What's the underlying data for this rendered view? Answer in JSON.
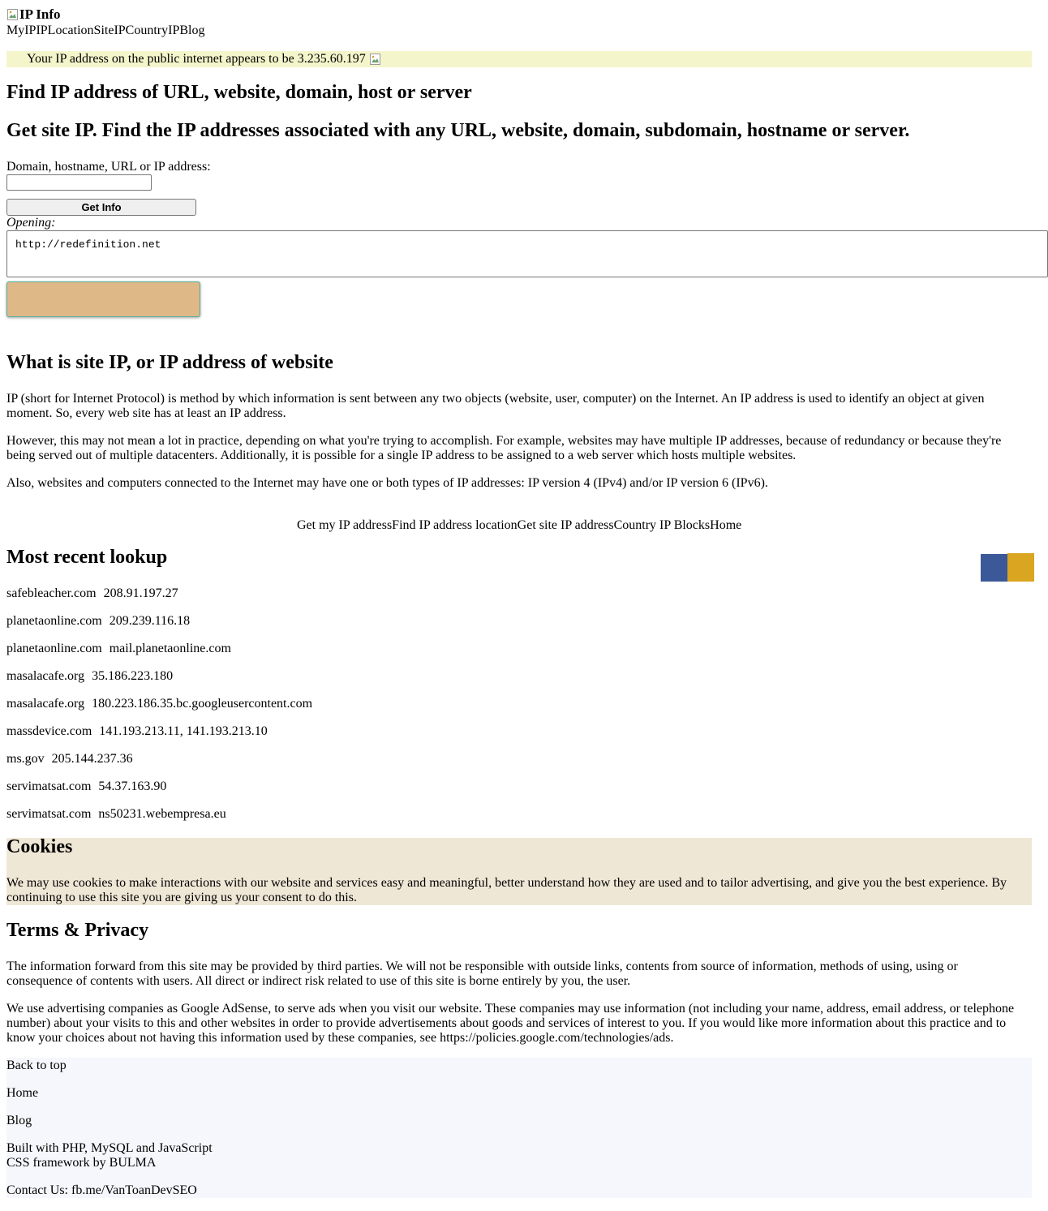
{
  "header": {
    "logo_alt": "IP Info",
    "nav": [
      "MyIP",
      "IPLocation",
      "SiteIP",
      "CountryIP",
      "Blog"
    ]
  },
  "ip_banner": {
    "text": "Your IP address on the public internet appears to be 3.235.60.197"
  },
  "main": {
    "title": "Find IP address of URL, website, domain, host or server",
    "subtitle": "Get site IP. Find the IP addresses associated with any URL, website, domain, subdomain, hostname or server.",
    "input_label": "Domain, hostname, URL or IP address:",
    "input_value": "",
    "button_label": "Get Info",
    "opening_label": "Opening:",
    "opening_value": "http://redefinition.net"
  },
  "about": {
    "heading": "What is site IP, or IP address of website",
    "paragraphs": [
      "IP (short for Internet Protocol) is method by which information is sent between any two objects (website, user, computer) on the Internet. An IP address is used to identify an object at given moment. So, every web site has at least an IP address.",
      "However, this may not mean a lot in practice, depending on what you're trying to accomplish. For example, websites may have multiple IP addresses, because of redundancy or because they're being served out of multiple datacenters. Additionally, it is possible for a single IP address to be assigned to a web server which hosts multiple websites.",
      "Also, websites and computers connected to the Internet may have one or both types of IP addresses: IP version 4 (IPv4) and/or IP version 6 (IPv6)."
    ]
  },
  "bottom_nav": [
    "Get my IP address",
    "Find IP address location",
    "Get site IP address",
    "Country IP Blocks",
    "Home"
  ],
  "recent": {
    "heading": "Most recent lookup",
    "items": [
      {
        "domain": "safebleacher.com",
        "ip": "208.91.197.27"
      },
      {
        "domain": "planetaonline.com",
        "ip": "209.239.116.18"
      },
      {
        "domain": "planetaonline.com",
        "ip": "mail.planetaonline.com"
      },
      {
        "domain": "masalacafe.org",
        "ip": "35.186.223.180"
      },
      {
        "domain": "masalacafe.org",
        "ip": "180.223.186.35.bc.googleusercontent.com"
      },
      {
        "domain": "massdevice.com",
        "ip": "141.193.213.11, 141.193.213.10"
      },
      {
        "domain": "ms.gov",
        "ip": "205.144.237.36"
      },
      {
        "domain": "servimatsat.com",
        "ip": "54.37.163.90"
      },
      {
        "domain": "servimatsat.com",
        "ip": "ns50231.webempresa.eu"
      }
    ],
    "share_colors": [
      "#3b5998",
      "#daa520"
    ]
  },
  "cookies": {
    "heading": "Cookies",
    "text": "We may use cookies to make interactions with our website and services easy and meaningful, better understand how they are used and to tailor advertising, and give you the best experience. By continuing to use this site you are giving us your consent to do this."
  },
  "terms": {
    "heading": "Terms & Privacy",
    "paragraphs": [
      "The information forward from this site may be provided by third parties. We will not be responsible with outside links, contents from source of information, methods of using, using or consequence of contents with users. All direct or indirect risk related to use of this site is borne entirely by you, the user.",
      "We use advertising companies as Google AdSense, to serve ads when you visit our website. These companies may use information (not including your name, address, email address, or telephone number) about your visits to this and other websites in order to provide advertisements about goods and services of interest to you. If you would like more information about this practice and to know your choices about not having this information used by these companies, see https://policies.google.com/technologies/ads."
    ]
  },
  "footer": {
    "back_to_top": "Back to top",
    "home": "Home",
    "blog": "Blog",
    "built_with": "Built with PHP, MySQL and JavaScript",
    "css_framework": "CSS framework by BULMA",
    "contact": "Contact Us: fb.me/VanToanDevSEO"
  },
  "colors": {
    "ip_banner_bg": "#f5f5cc",
    "button_orange": "#dfb887",
    "cookies_bg": "#efe7d6",
    "footer_bg": "#f6f7fc"
  },
  "icons": [
    "broken-image-icon"
  ]
}
